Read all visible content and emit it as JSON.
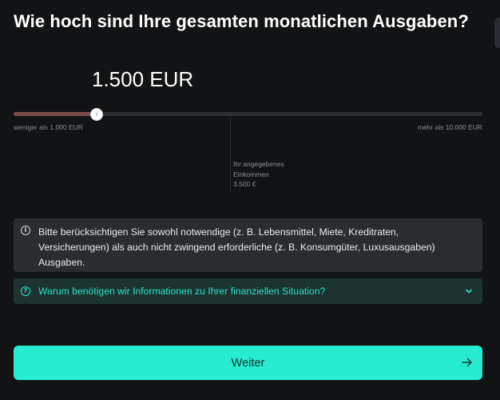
{
  "question": "Wie hoch sind Ihre gesamten monatlichen Ausgaben?",
  "amount_display": "1.500 EUR",
  "slider": {
    "value_fraction": 0.177,
    "min_label": "weniger als 1.000 EUR",
    "max_label": "mehr als 10.000 EUR",
    "fill_color": "#7a4b4b",
    "thumb_glyph": "||"
  },
  "income_marker": {
    "position_fraction": 0.462,
    "line1": "Ihr angegebenes",
    "line2": "Einkommen",
    "line3": "3.500 €"
  },
  "info": {
    "icon": "info-icon",
    "icon_glyph": "i",
    "text": "Bitte berücksichtigen Sie sowohl notwendige (z. B. Lebensmittel, Miete, Kreditraten, Versicherungen) als auch nicht zwingend erforderliche (z. B. Konsumgüter, Luxusausgaben) Ausgaben."
  },
  "accordion": {
    "icon": "question-circle-icon",
    "icon_glyph": "?",
    "label": "Warum benötigen wir Informationen zu Ihrer finanziellen Situation?",
    "accent_color": "#27e2c8"
  },
  "next_button": {
    "label": "Weiter",
    "icon": "arrow-right-icon",
    "color": "#27ecd2"
  }
}
